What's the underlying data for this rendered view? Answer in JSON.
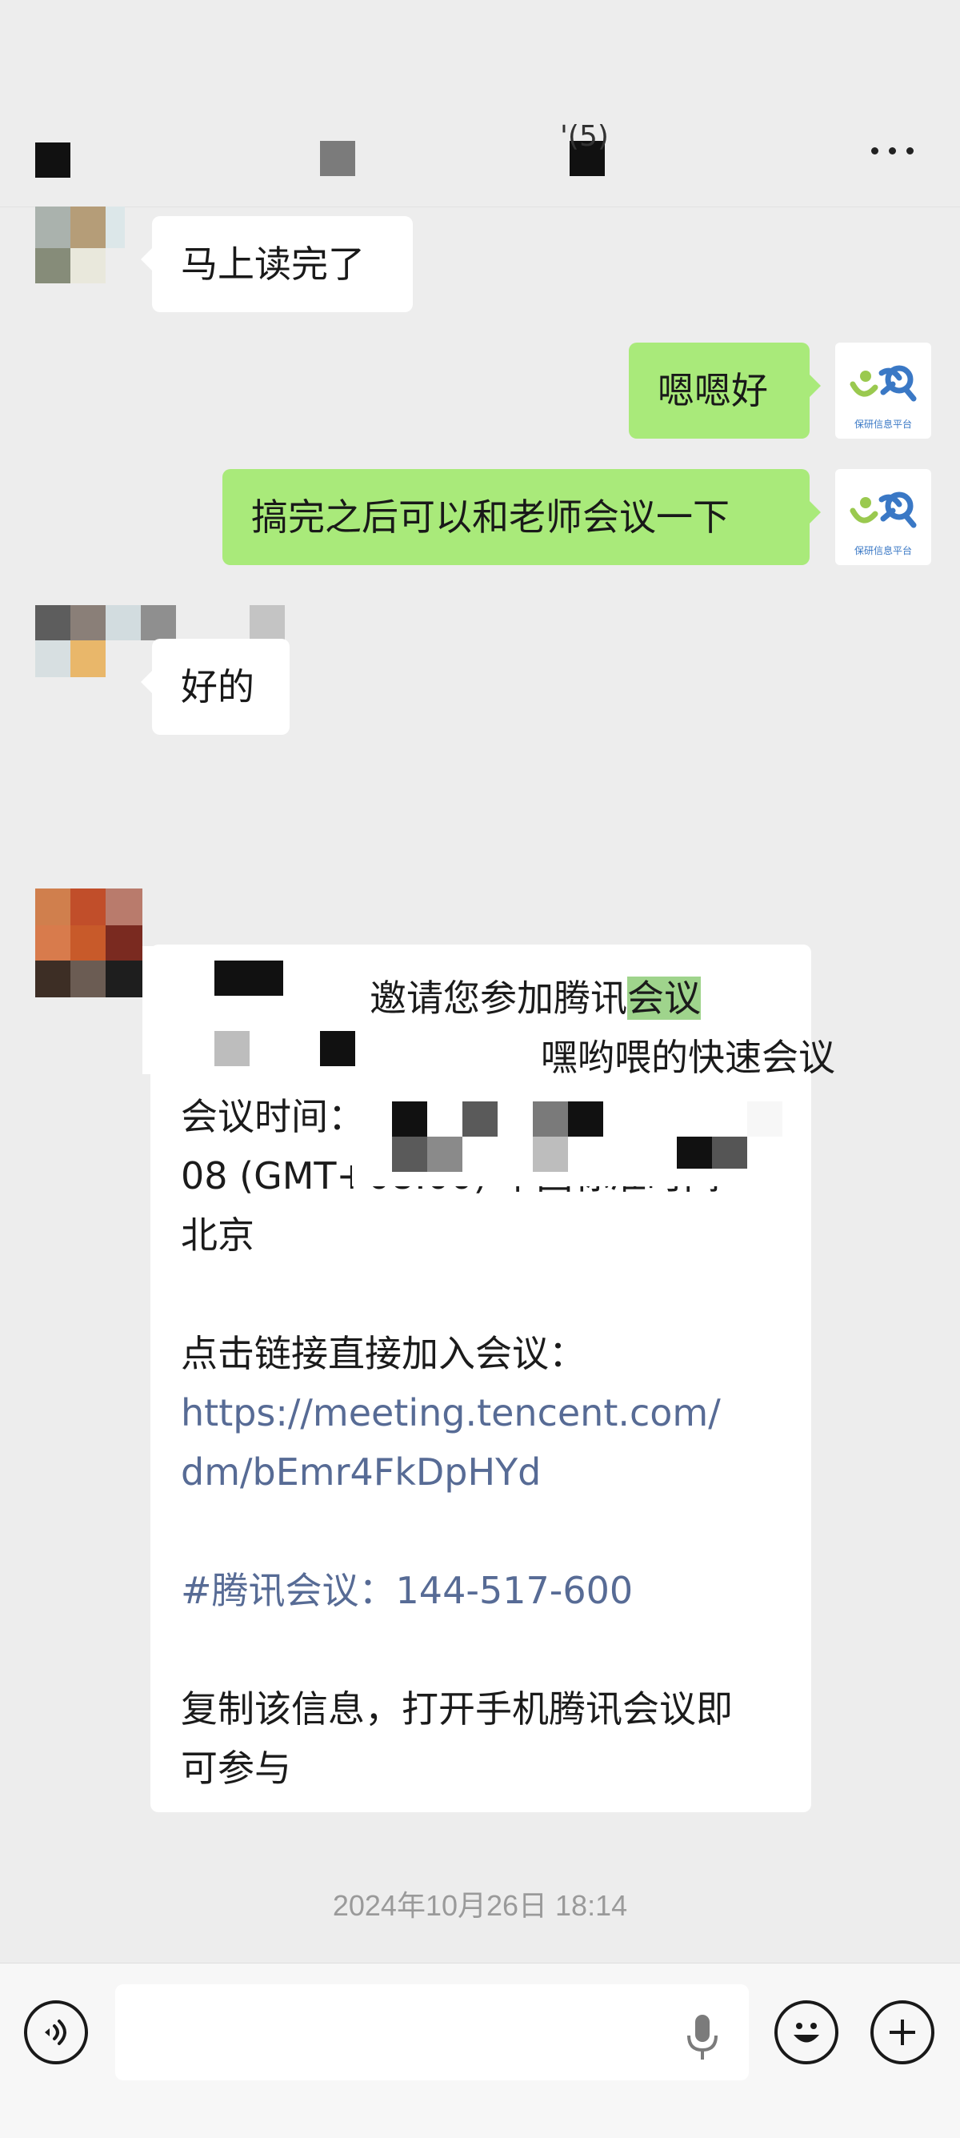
{
  "header": {
    "title_fragment": "'(5)",
    "more_icon": "more-dots-icon"
  },
  "messages": [
    {
      "side": "left",
      "text": "马上读完了"
    },
    {
      "side": "right",
      "text": "嗯嗯好"
    },
    {
      "side": "right",
      "text": "搞完之后可以和老师会议一下"
    },
    {
      "side": "left",
      "text": "好的"
    }
  ],
  "self_avatar": {
    "label": "保研信息平台"
  },
  "meeting_card": {
    "line1_suffix": "邀请您参加腾讯",
    "line1_highlight": "会议",
    "line2": "嘿哟喂的快速会议",
    "line3": "会议时间：",
    "line4": "08 (GMT+08:00) 中国标准时间 -",
    "line5": "北京",
    "join_label": "点击链接直接加入会议：",
    "link_line1": "https://meeting.tencent.com/",
    "link_line2": "dm/bEmr4FkDpHYd",
    "meeting_id": "#腾讯会议：144-517-600",
    "footer_line1": "复制该信息，打开手机腾讯会议即",
    "footer_line2": "可参与"
  },
  "timestamp": "2024年10月26日 18:14",
  "input_bar": {
    "voice_icon": "voice-toggle-icon",
    "mic_icon": "microphone-icon",
    "emoji_icon": "emoji-icon",
    "plus_icon": "plus-icon",
    "message_value": ""
  },
  "colors": {
    "background": "#ededed",
    "incoming_bubble": "#ffffff",
    "outgoing_bubble": "#a9ea7a",
    "link": "#576b95",
    "highlight": "#9fd48c"
  }
}
